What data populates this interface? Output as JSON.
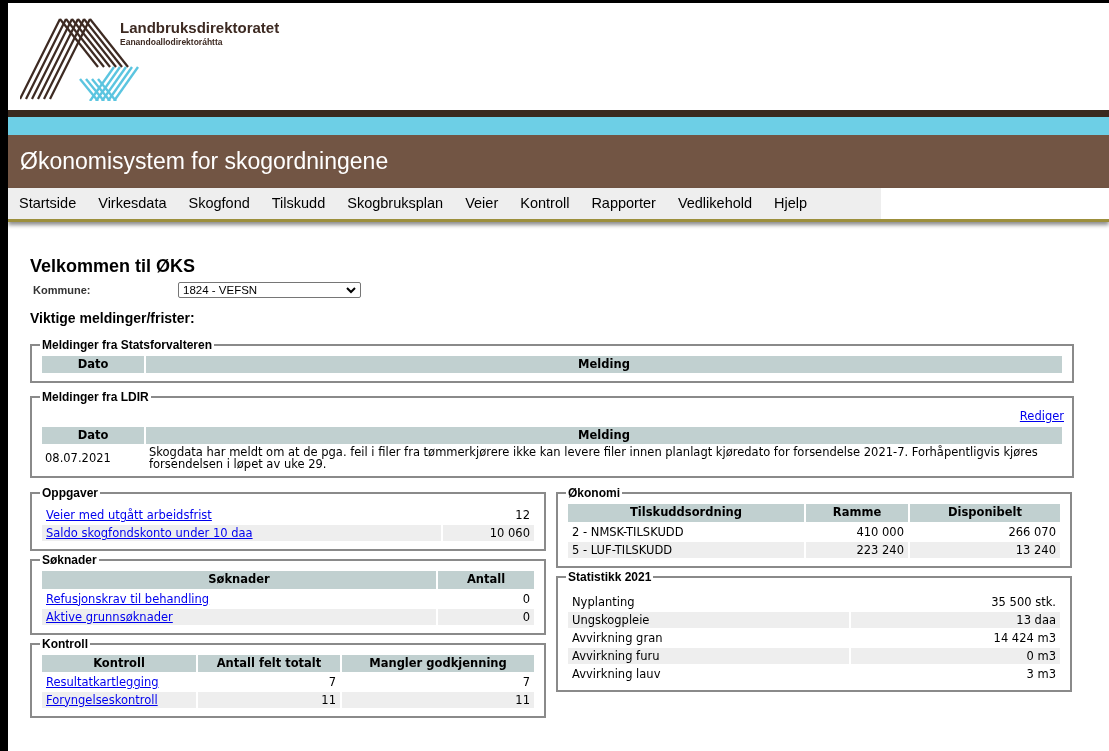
{
  "header": {
    "org_name": "Landbruksdirektoratet",
    "org_subname": "Eanandoallodirektoráhtta",
    "app_title": "Økonomisystem for skogordningene"
  },
  "nav": [
    {
      "label": "Startside"
    },
    {
      "label": "Virkesdata"
    },
    {
      "label": "Skogfond"
    },
    {
      "label": "Tilskudd"
    },
    {
      "label": "Skogbruksplan"
    },
    {
      "label": "Veier"
    },
    {
      "label": "Kontroll"
    },
    {
      "label": "Rapporter"
    },
    {
      "label": "Vedlikehold"
    },
    {
      "label": "Hjelp"
    }
  ],
  "welcome": {
    "title": "Velkommen til ØKS",
    "kommune_label": "Kommune:",
    "kommune_value": "1824 - VEFSN",
    "important_heading": "Viktige meldinger/frister:"
  },
  "statsforvalteren": {
    "legend": "Meldinger fra Statsforvalteren",
    "columns": [
      "Dato",
      "Melding"
    ]
  },
  "ldir": {
    "legend": "Meldinger fra LDIR",
    "edit_link": "Rediger",
    "columns": [
      "Dato",
      "Melding"
    ],
    "rows": [
      {
        "date": "08.07.2021",
        "message": "Skogdata har meldt om at de pga. feil i filer fra tømmerkjørere ikke kan levere filer innen planlagt kjøredato for forsendelse 2021-7. Forhåpentligvis kjøres forsendelsen i løpet av uke 29."
      }
    ]
  },
  "oppgaver": {
    "legend": "Oppgaver",
    "rows": [
      {
        "label": "Veier med utgått arbeidsfrist",
        "value": "12"
      },
      {
        "label": "Saldo skogfondskonto under 10 daa",
        "value": "10 060"
      }
    ]
  },
  "soknader": {
    "legend": "Søknader",
    "columns": [
      "Søknader",
      "Antall"
    ],
    "rows": [
      {
        "label": "Refusjonskrav til behandling",
        "value": "0"
      },
      {
        "label": "Aktive grunnsøknader",
        "value": "0"
      }
    ]
  },
  "kontroll": {
    "legend": "Kontroll",
    "columns": [
      "Kontroll",
      "Antall felt totalt",
      "Mangler godkjenning"
    ],
    "rows": [
      {
        "label": "Resultatkartlegging",
        "total": "7",
        "missing": "7"
      },
      {
        "label": "Foryngelseskontroll",
        "total": "11",
        "missing": "11"
      }
    ]
  },
  "okonomi": {
    "legend": "Økonomi",
    "columns": [
      "Tilskuddsordning",
      "Ramme",
      "Disponibelt"
    ],
    "rows": [
      {
        "label": "2 - NMSK-TILSKUDD",
        "ramme": "410 000",
        "disponibelt": "266 070"
      },
      {
        "label": "5 - LUF-TILSKUDD",
        "ramme": "223 240",
        "disponibelt": "13 240"
      }
    ]
  },
  "statistikk": {
    "legend": "Statistikk 2021",
    "rows": [
      {
        "label": "Nyplanting",
        "value": "35 500 stk."
      },
      {
        "label": "Ungskogpleie",
        "value": "13 daa"
      },
      {
        "label": "Avvirkning gran",
        "value": "14 424 m3"
      },
      {
        "label": "Avvirkning furu",
        "value": "0 m3"
      },
      {
        "label": "Avvirkning lauv",
        "value": "3 m3"
      }
    ]
  }
}
